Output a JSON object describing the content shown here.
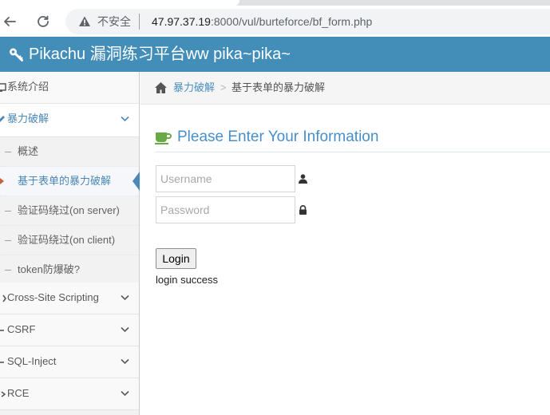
{
  "browser": {
    "security_label": "不安全",
    "url_host": "47.97.37.19",
    "url_rest": ":8000/vul/burteforce/bf_form.php"
  },
  "header": {
    "title": "Pikachu 漏洞练习平台ww pika~pika~",
    "icon": "wrench-key-icon",
    "bg_color": "#438eb9"
  },
  "sidebar": {
    "items": [
      {
        "label": "系统介绍",
        "icon": "desktop-icon"
      },
      {
        "label": "暴力破解",
        "icon": "pencil-icon",
        "expanded": true
      },
      {
        "label": "Cross-Site Scripting",
        "icon": "code-icon"
      },
      {
        "label": "CSRF",
        "icon": "link-icon"
      },
      {
        "label": "SQL-Inject",
        "icon": "database-icon"
      },
      {
        "label": "RCE",
        "icon": "terminal-icon"
      }
    ],
    "submenu": [
      {
        "label": "概述"
      },
      {
        "label": "基于表单的暴力破解",
        "current": true
      },
      {
        "label": "验证码绕过(on server)"
      },
      {
        "label": "验证码绕过(on client)"
      },
      {
        "label": "token防爆破?"
      }
    ]
  },
  "breadcrumbs": {
    "parent": "暴力破解",
    "separator": ">",
    "current": "基于表单的暴力破解"
  },
  "form": {
    "heading": "Please Enter Your Information",
    "username_placeholder": "Username",
    "password_placeholder": "Password",
    "login_label": "Login",
    "result_message": "login success"
  }
}
